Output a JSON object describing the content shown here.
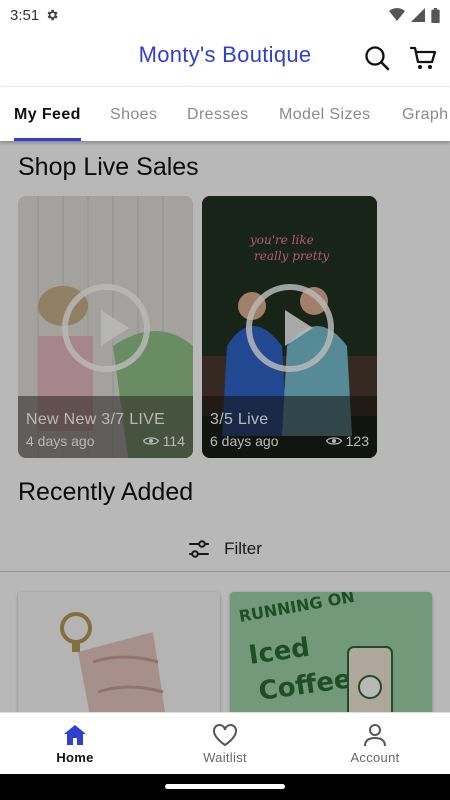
{
  "status_bar": {
    "time": "3:51"
  },
  "header": {
    "title": "Monty's Boutique"
  },
  "tabs": [
    {
      "label": "My Feed"
    },
    {
      "label": "Shoes"
    },
    {
      "label": "Dresses"
    },
    {
      "label": "Model Sizes"
    },
    {
      "label": "Graph"
    }
  ],
  "live_sales": {
    "title": "Shop Live Sales",
    "items": [
      {
        "title": "New New 3/7 LIVE",
        "age": "4 days ago",
        "views": "114"
      },
      {
        "title": "3/5 Live",
        "age": "6 days ago",
        "views": "123"
      }
    ]
  },
  "recent": {
    "title": "Recently Added",
    "filter_label": "Filter"
  },
  "bottom_nav": [
    {
      "label": "Home"
    },
    {
      "label": "Waitlist"
    },
    {
      "label": "Account"
    }
  ],
  "colors": {
    "accent": "#2f3fd0"
  }
}
